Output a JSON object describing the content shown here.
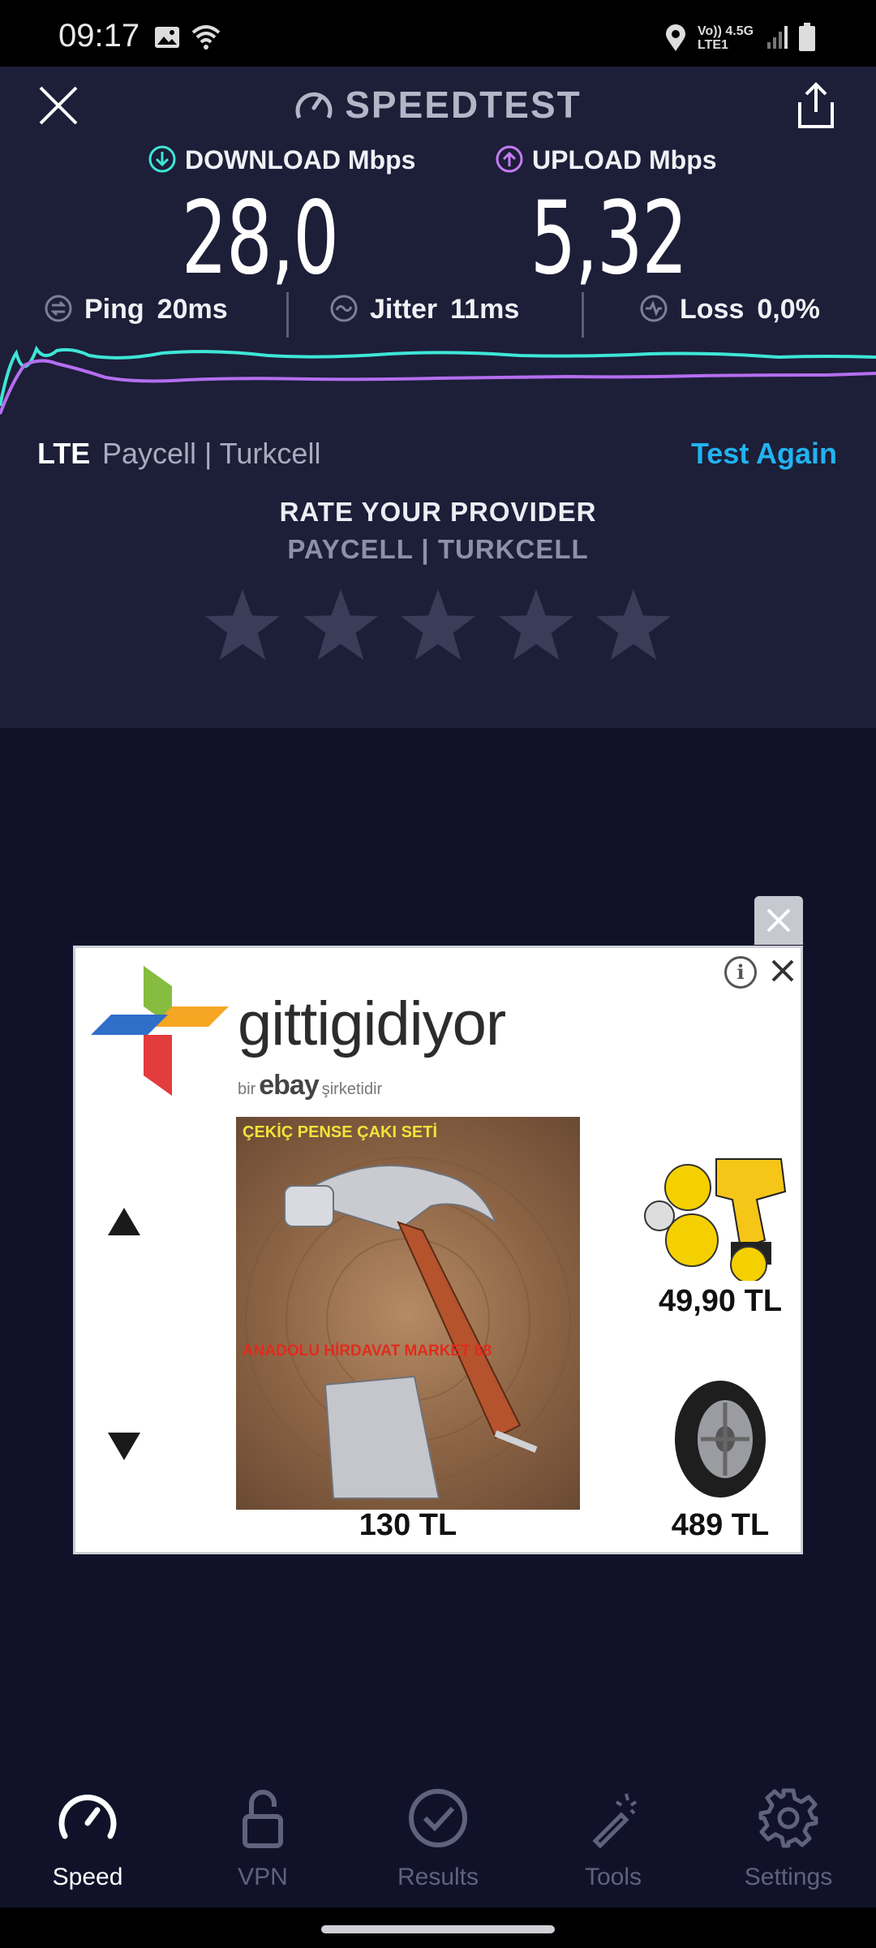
{
  "status_bar": {
    "time": "09:17",
    "icons": [
      "image-icon",
      "wifi-icon",
      "location-icon",
      "volte-lte-icon",
      "signal-icon",
      "battery-icon"
    ],
    "volte_label": "Vo)) 4.5G LTE1"
  },
  "header": {
    "brand": "SPEEDTEST"
  },
  "download": {
    "label": "DOWNLOAD Mbps",
    "value": "28,0",
    "color": "#3ee6d6"
  },
  "upload": {
    "label": "UPLOAD Mbps",
    "value": "5,32",
    "color": "#c77cf4"
  },
  "stats": {
    "ping": {
      "label": "Ping",
      "value": "20ms"
    },
    "jitter": {
      "label": "Jitter",
      "value": "11ms"
    },
    "loss": {
      "label": "Loss",
      "value": "0,0%"
    }
  },
  "connection": {
    "type": "LTE",
    "provider": "Paycell | Turkcell",
    "test_again": "Test Again"
  },
  "rating": {
    "title": "RATE YOUR PROVIDER",
    "provider": "PAYCELL | TURKCELL",
    "stars": 5
  },
  "ad": {
    "brand": "gittigidiyor",
    "tagline_pre": "bir",
    "tagline_ebay": "ebay",
    "tagline_post": "şirketidir",
    "info": "i",
    "main_caption_1": "ÇEKİÇ PENSE ÇAKI SETİ",
    "main_caption_2": "ANADOLU HİRDAVAT MARKET 68",
    "main_price": "130 TL",
    "side_price_1": "49,90 TL",
    "side_price_2": "489 TL"
  },
  "nav": {
    "items": [
      {
        "label": "Speed",
        "icon": "gauge-icon"
      },
      {
        "label": "VPN",
        "icon": "lock-icon"
      },
      {
        "label": "Results",
        "icon": "check-circle-icon"
      },
      {
        "label": "Tools",
        "icon": "magic-wand-icon"
      },
      {
        "label": "Settings",
        "icon": "gear-icon"
      }
    ],
    "active": "Speed"
  },
  "colors": {
    "accent": "#21b3f0",
    "panel": "#1d1e38",
    "background": "#11122a"
  }
}
